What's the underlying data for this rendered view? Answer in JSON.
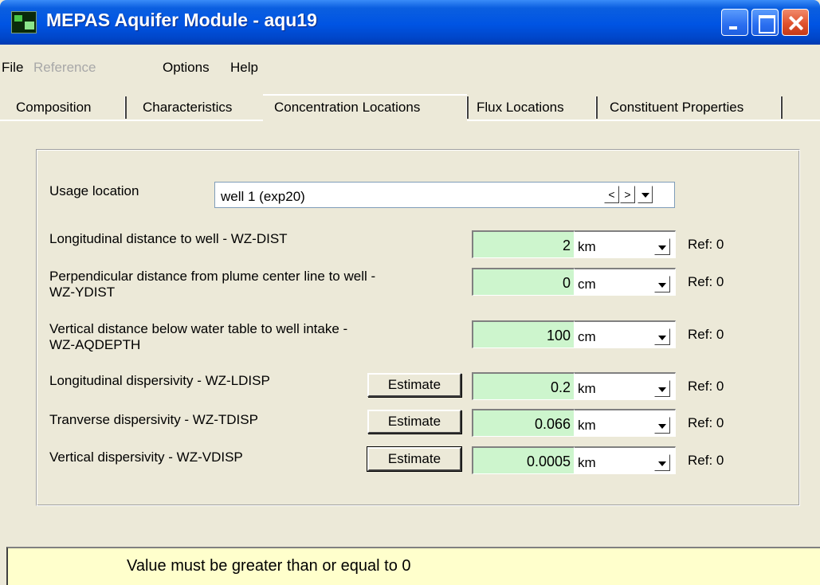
{
  "window": {
    "title": "MEPAS Aquifer Module - aqu19",
    "app_icon": "mepas-app-icon",
    "controls": [
      "minimize-icon",
      "maximize-icon",
      "close-icon"
    ]
  },
  "menu": {
    "file": "File",
    "reference": "Reference",
    "options": "Options",
    "help": "Help"
  },
  "tabs": [
    {
      "label": "Composition",
      "active": false
    },
    {
      "label": "Characteristics",
      "active": false
    },
    {
      "label": "Concentration Locations",
      "active": true
    },
    {
      "label": "Flux Locations",
      "active": false
    },
    {
      "label": "Constituent Properties",
      "active": false
    }
  ],
  "usage": {
    "label": "Usage location",
    "value": "well 1 (exp20)",
    "prev": "<",
    "next": ">"
  },
  "estimate_label": "Estimate",
  "params": [
    {
      "label": "Longitudinal distance to well - WZ-DIST",
      "value": "2",
      "unit": "km",
      "ref": "Ref: 0"
    },
    {
      "label": "Perpendicular distance from plume center line to well -",
      "label2": "WZ-YDIST",
      "value": "0",
      "unit": "cm",
      "ref": "Ref: 0"
    },
    {
      "label": "Vertical distance below water table to well intake -",
      "label2": "WZ-AQDEPTH",
      "value": "100",
      "unit": "cm",
      "ref": "Ref: 0"
    },
    {
      "label": "Longitudinal dispersivity - WZ-LDISP",
      "value": "0.2",
      "unit": "km",
      "ref": "Ref: 0"
    },
    {
      "label": "Tranverse dispersivity - WZ-TDISP",
      "value": "0.066",
      "unit": "km",
      "ref": "Ref: 0"
    },
    {
      "label": "Vertical dispersivity - WZ-VDISP",
      "value": "0.0005",
      "unit": "km",
      "ref": "Ref: 0"
    }
  ],
  "status": {
    "message": "Value must be greater than or equal to 0"
  },
  "colors": {
    "titlebar": "#0054e3",
    "value_field": "#cdf5cd",
    "status_bg": "#ffffcc",
    "window_bg": "#ece9d8"
  }
}
